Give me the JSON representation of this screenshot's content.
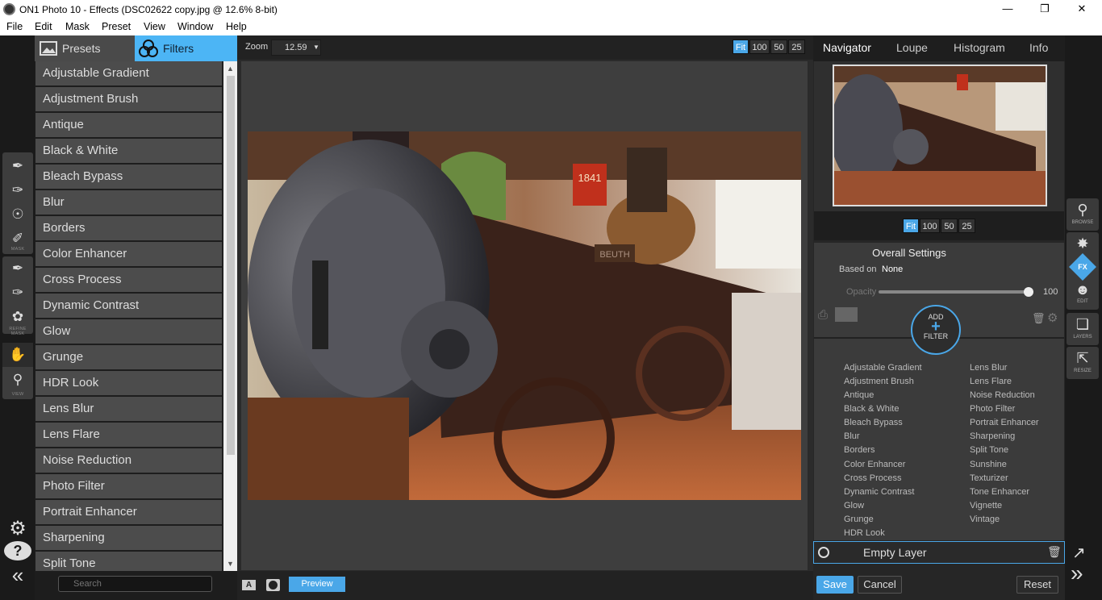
{
  "window": {
    "title": "ON1 Photo 10 - Effects (DSC02622 copy.jpg @ 12.6% 8-bit)"
  },
  "menu": [
    "File",
    "Edit",
    "Mask",
    "Preset",
    "View",
    "Window",
    "Help"
  ],
  "left_tools": {
    "captions": [
      "MASK",
      "REFINE MASK",
      "VIEW"
    ]
  },
  "panel_tabs": {
    "presets": "Presets",
    "filters": "Filters"
  },
  "filters": [
    "Adjustable Gradient",
    "Adjustment Brush",
    "Antique",
    "Black & White",
    "Bleach Bypass",
    "Blur",
    "Borders",
    "Color Enhancer",
    "Cross Process",
    "Dynamic Contrast",
    "Glow",
    "Grunge",
    "HDR Look",
    "Lens Blur",
    "Lens Flare",
    "Noise Reduction",
    "Photo Filter",
    "Portrait Enhancer",
    "Sharpening",
    "Split Tone"
  ],
  "search": {
    "placeholder": "Search"
  },
  "zoom": {
    "label": "Zoom",
    "value": "12.59",
    "buttons": [
      "Fit",
      "100",
      "50",
      "25"
    ],
    "active": "Fit"
  },
  "bottom": {
    "a_label": "A",
    "preview": "Preview"
  },
  "right_tabs": [
    "Navigator",
    "Loupe",
    "Histogram",
    "Info"
  ],
  "overall": {
    "title": "Overall Settings",
    "based_on_label": "Based on",
    "based_on_value": "None",
    "opacity_label": "Opacity",
    "opacity_value": "100",
    "opacity_level": 1.0
  },
  "add_filter": {
    "line1": "ADD",
    "plus": "+",
    "line2": "FILTER"
  },
  "add_list_left": [
    "Adjustable Gradient",
    "Adjustment Brush",
    "Antique",
    "Black & White",
    "Bleach Bypass",
    "Blur",
    "Borders",
    "Color Enhancer",
    "Cross Process",
    "Dynamic Contrast",
    "Glow",
    "Grunge",
    "HDR Look"
  ],
  "add_list_right": [
    "Lens Blur",
    "Lens Flare",
    "Noise Reduction",
    "Photo Filter",
    "Portrait Enhancer",
    "Sharpening",
    "Split Tone",
    "Sunshine",
    "Texturizer",
    "Tone Enhancer",
    "Vignette",
    "Vintage"
  ],
  "layer": {
    "name": "Empty Layer"
  },
  "actions": {
    "save": "Save",
    "cancel": "Cancel",
    "reset": "Reset"
  },
  "right_tools": [
    "BROWSE",
    "EDIT",
    "LAYERS",
    "RESIZE"
  ],
  "photo_sign": "1841",
  "photo_plate": "BEUTH",
  "colors": {
    "accent": "#4aa7e8",
    "panel": "#4c4c4c"
  }
}
